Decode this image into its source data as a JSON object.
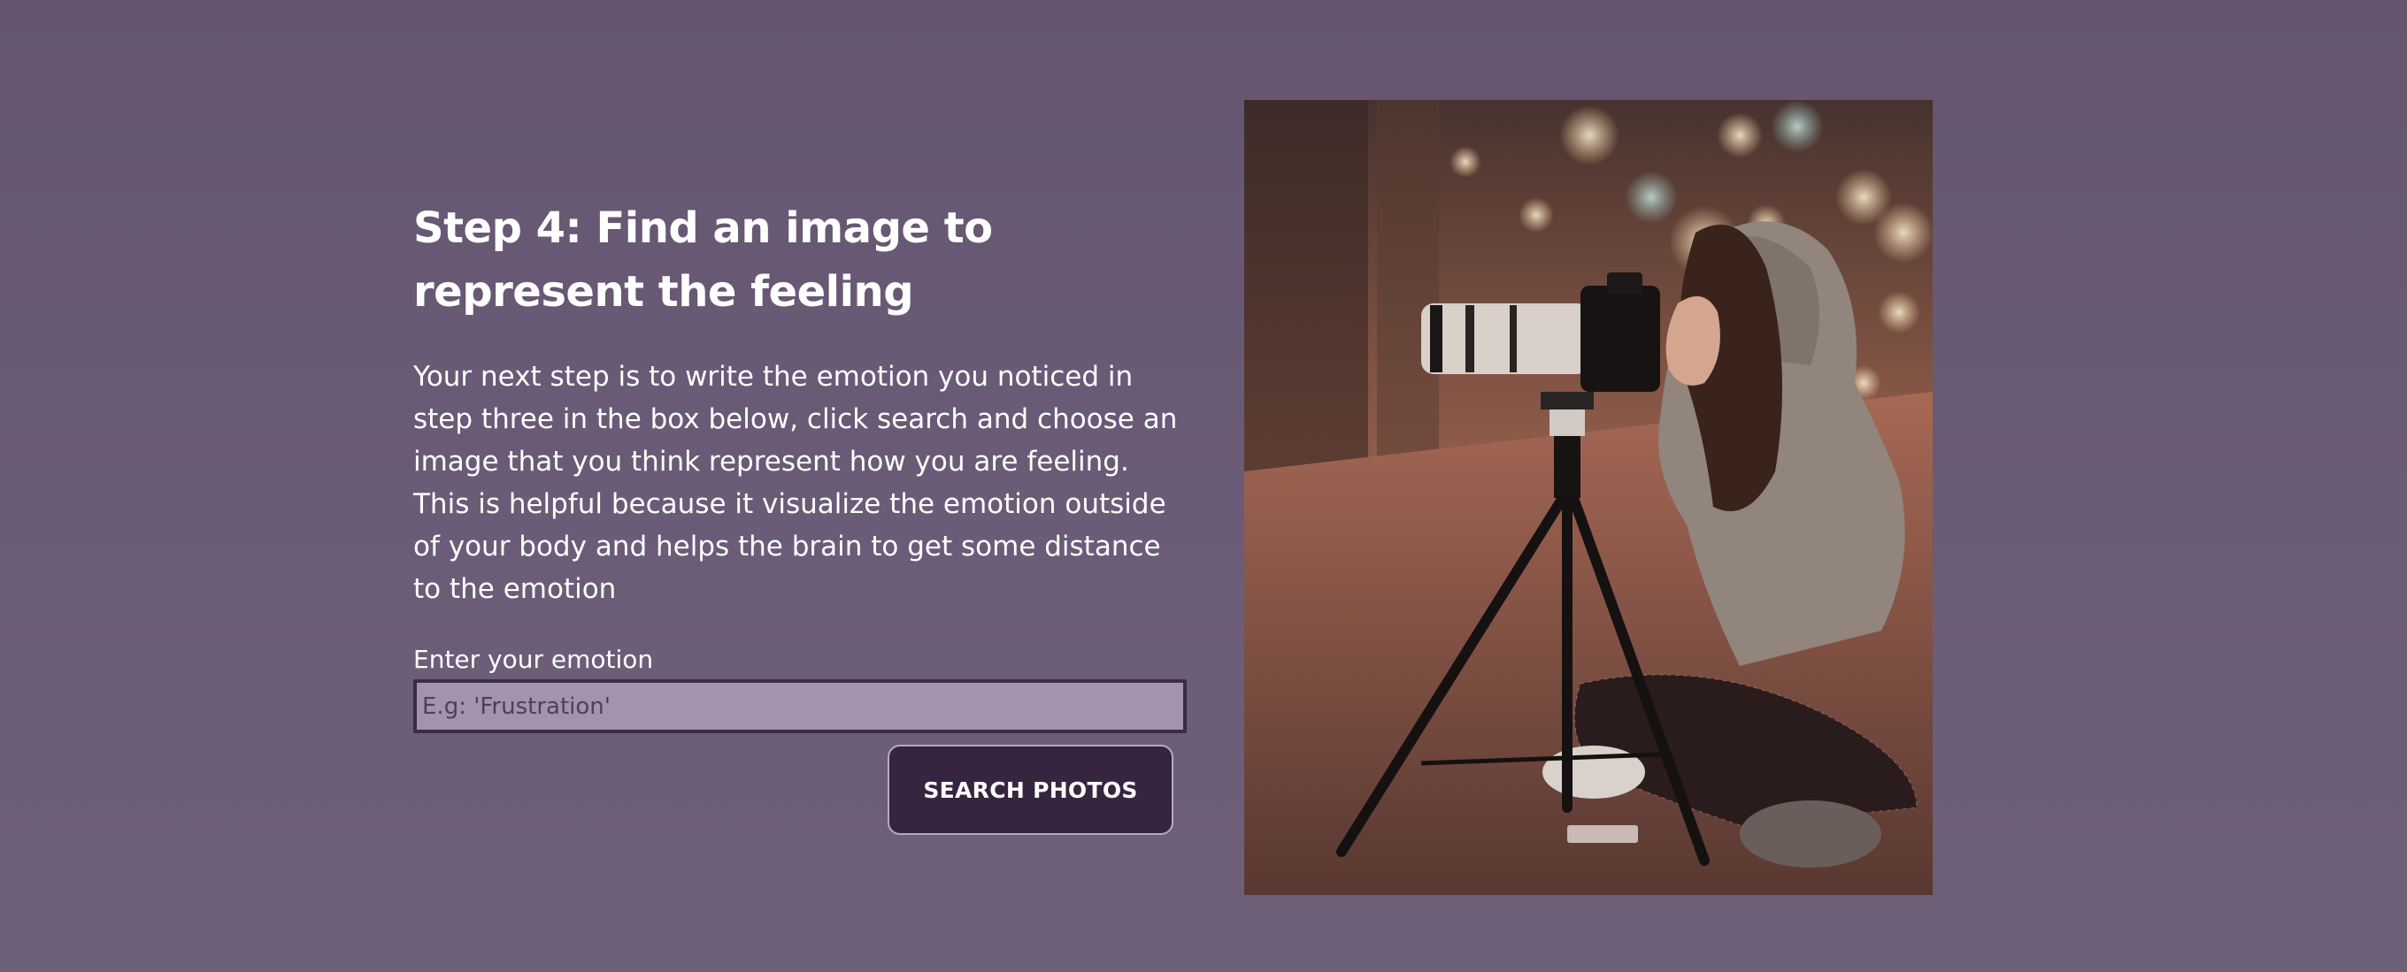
{
  "step": {
    "heading": "Step 4: Find an image to represent the feeling",
    "description": "Your next step is to write the emotion you noticed in step three in the box below, click search and choose an image that you think represent how you are feeling. This is helpful because it visualize the emotion outside of your body and helps the brain to get some distance to the emotion"
  },
  "form": {
    "input_label": "Enter your emotion",
    "input_placeholder": "E.g: 'Frustration'",
    "input_value": "",
    "button_label": "SEARCH PHOTOS"
  },
  "colors": {
    "background": "#685a74",
    "input_fill": "#a592ac",
    "input_border": "#3d2c45",
    "button_fill": "#37243f",
    "text": "#ffffff"
  },
  "photo": {
    "subject": "woman-with-camera-on-tripod-at-night"
  }
}
